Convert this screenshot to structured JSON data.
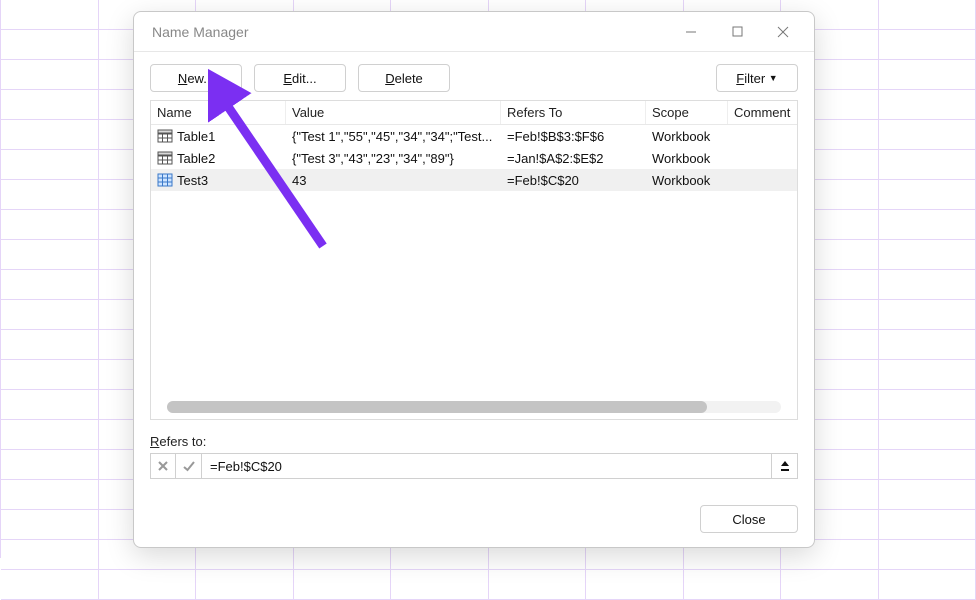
{
  "dialog": {
    "title": "Name Manager",
    "toolbar": {
      "new_prefix": "N",
      "new_rest": "ew...",
      "edit_prefix": "E",
      "edit_rest": "dit...",
      "delete_prefix": "D",
      "delete_rest": "elete",
      "filter_prefix": "F",
      "filter_rest": "ilter"
    }
  },
  "columns": {
    "name": "Name",
    "value": "Value",
    "refers_to": "Refers To",
    "scope": "Scope",
    "comment": "Comment"
  },
  "rows": [
    {
      "icon": "table",
      "name": "Table1",
      "value": "{\"Test 1\",\"55\",\"45\",\"34\",\"34\";\"Test...",
      "refers_to": "=Feb!$B$3:$F$6",
      "scope": "Workbook",
      "comment": "",
      "selected": false
    },
    {
      "icon": "table",
      "name": "Table2",
      "value": "{\"Test 3\",\"43\",\"23\",\"34\",\"89\"}",
      "refers_to": "=Jan!$A$2:$E$2",
      "scope": "Workbook",
      "comment": "",
      "selected": false
    },
    {
      "icon": "name",
      "name": "Test3",
      "value": "43",
      "refers_to": "=Feb!$C$20",
      "scope": "Workbook",
      "comment": "",
      "selected": true
    }
  ],
  "refers": {
    "label_prefix": "R",
    "label_rest": "efers to:",
    "value": "=Feb!$C$20"
  },
  "footer": {
    "close": "Close"
  }
}
